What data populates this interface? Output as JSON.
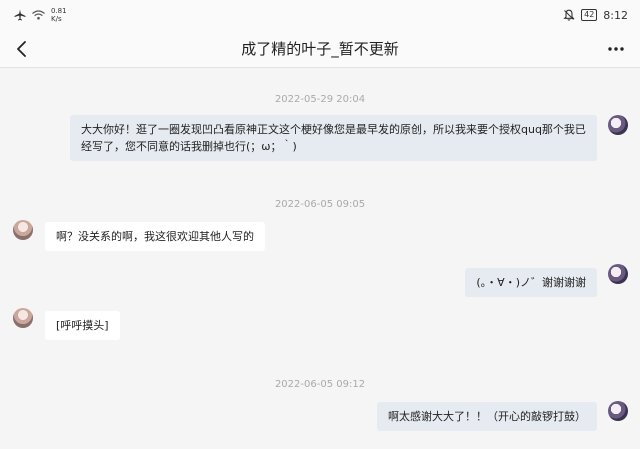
{
  "status_bar": {
    "net_speed_value": "0.81",
    "net_speed_unit": "K/s",
    "battery": "42",
    "time": "8:12"
  },
  "header": {
    "title": "成了精的叶子_暂不更新"
  },
  "messages": [
    {
      "type": "timestamp",
      "text": "2022-05-29 20:04"
    },
    {
      "type": "self",
      "text": "大大你好！逛了一圈发现凹凸看原神正文这个梗好像您是最早发的原创，所以我来要个授权quq那个我已经写了，您不同意的话我删掉也行(；ω；｀)"
    },
    {
      "type": "timestamp",
      "text": "2022-06-05 09:05"
    },
    {
      "type": "other",
      "text": "啊？没关系的啊，我这很欢迎其他人写的"
    },
    {
      "type": "self",
      "text": "(。・∀・)ノ゛谢谢谢谢"
    },
    {
      "type": "other",
      "text": "[呼呼摸头]"
    },
    {
      "type": "timestamp",
      "text": "2022-06-05 09:12"
    },
    {
      "type": "self",
      "text": "啊太感谢大大了！！（开心的敲锣打鼓）"
    }
  ]
}
